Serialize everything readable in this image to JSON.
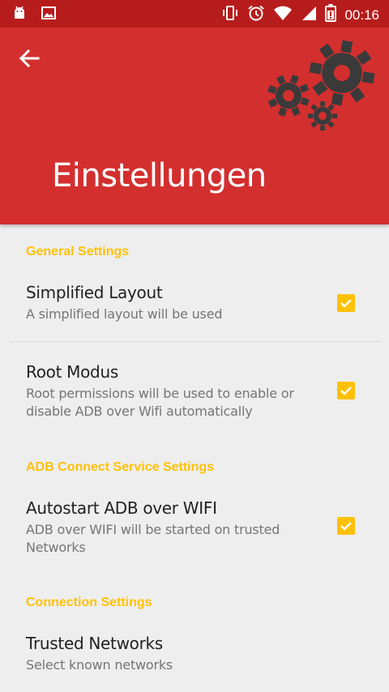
{
  "status_bar": {
    "time": "00:16",
    "icons": [
      "android-icon",
      "image-icon",
      "vibrate-icon",
      "alarm-icon",
      "wifi-icon",
      "signal-icon",
      "battery-icon"
    ]
  },
  "app_bar": {
    "title": "Einstellungen",
    "color": "#D32F2F",
    "status_color": "#B71C1C"
  },
  "sections": {
    "general": {
      "header": "General Settings",
      "simplified_layout": {
        "title": "Simplified Layout",
        "summary": "A simplified layout will be used",
        "checked": true
      },
      "root_modus": {
        "title": "Root Modus",
        "summary": "Root permissions will be used to enable or disable ADB over Wifi automatically",
        "checked": true
      }
    },
    "adb": {
      "header": "ADB Connect Service Settings",
      "autostart": {
        "title": "Autostart ADB over WIFI",
        "summary": "ADB over WIFI will be started on trusted Networks",
        "checked": true
      }
    },
    "connection": {
      "header": "Connection Settings",
      "trusted_networks": {
        "title": "Trusted Networks",
        "summary": "Select known networks"
      }
    }
  },
  "accent_color": "#FFC107"
}
